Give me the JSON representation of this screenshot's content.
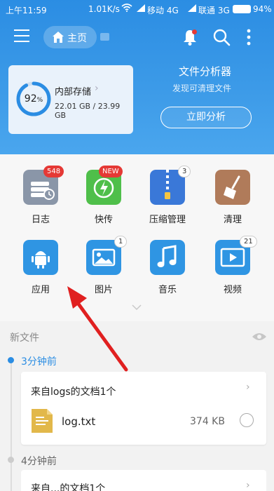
{
  "status_bar": {
    "time": "上午11:59",
    "net_speed": "1.01K/s",
    "carrier1": "移动 4G",
    "carrier2": "联通 3G",
    "battery": "94%"
  },
  "toolbar": {
    "home_label": "主页"
  },
  "storage": {
    "percent": "92",
    "percent_unit": "%",
    "title": "内部存储",
    "size": "22.01 GB / 23.99 GB",
    "used_fraction": 0.92
  },
  "analyzer": {
    "title": "文件分析器",
    "subtitle": "发现可清理文件",
    "button": "立即分析"
  },
  "categories": [
    {
      "label": "日志",
      "badge": "548",
      "color": "#8a96a8"
    },
    {
      "label": "快传",
      "badge": "NEW",
      "color": "#4fbf4a"
    },
    {
      "label": "压缩管理",
      "badge": "3",
      "color": "#3a78d8"
    },
    {
      "label": "清理",
      "badge": "",
      "color": "#b07b5a"
    },
    {
      "label": "应用",
      "badge": "",
      "color": "#2f95e3"
    },
    {
      "label": "图片",
      "badge": "1",
      "color": "#2f95e3"
    },
    {
      "label": "音乐",
      "badge": "",
      "color": "#2f95e3"
    },
    {
      "label": "视频",
      "badge": "21",
      "color": "#2f95e3"
    }
  ],
  "recent": {
    "section_label": "新文件",
    "groups": [
      {
        "time": "3分钟前",
        "card_title": "来自logs的文档1个",
        "file_name": "log.txt",
        "file_size": "374 KB"
      },
      {
        "time": "4分钟前",
        "card_title": "来自...的文档1个"
      }
    ]
  },
  "colors": {
    "primary": "#2b8de3",
    "badge_red": "#e53935",
    "annotation_arrow": "#e02020"
  }
}
